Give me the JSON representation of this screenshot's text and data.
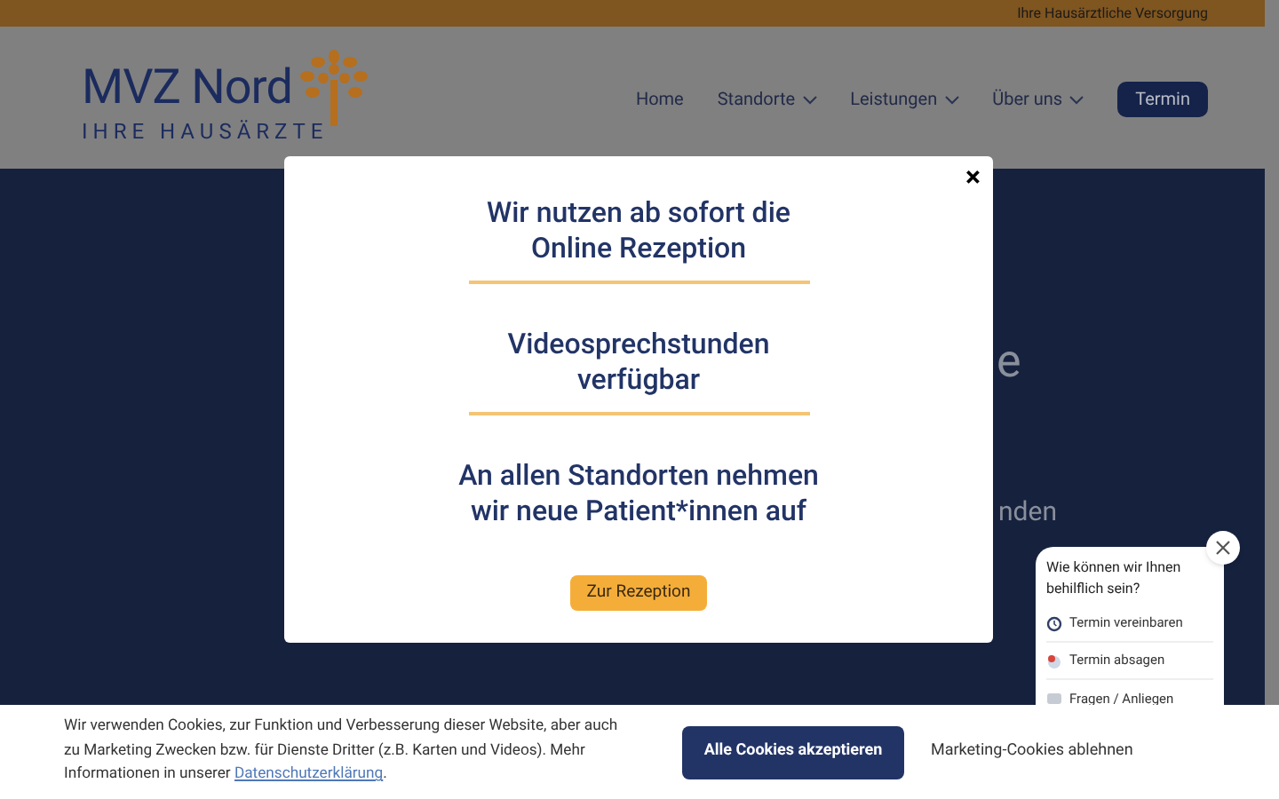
{
  "top_bar": {
    "text": "Ihre Hausärztliche Versorgung"
  },
  "logo": {
    "name": "MVZ Nord",
    "tagline": "IHRE HAUSÄRZTE"
  },
  "nav": [
    {
      "label": "Home",
      "dropdown": false
    },
    {
      "label": "Standorte",
      "dropdown": true
    },
    {
      "label": "Leistungen",
      "dropdown": true
    },
    {
      "label": "Über uns",
      "dropdown": true
    }
  ],
  "nav_button": "Termin",
  "hero_fragments": [
    "e",
    "nden"
  ],
  "modal": {
    "close": "×",
    "sections": [
      "Wir nutzen ab sofort die Online Rezeption",
      "Videosprechstunden verfügbar",
      "An allen Standorten nehmen wir neue Patient*innen auf"
    ],
    "button": "Zur Rezeption"
  },
  "chat": {
    "question": "Wie können wir Ihnen behilflich sein?",
    "options": [
      {
        "label": "Termin vereinbaren",
        "kind": "clock"
      },
      {
        "label": "Termin absagen",
        "kind": "cancel"
      },
      {
        "label": "Fragen / Anliegen",
        "kind": "chat"
      }
    ]
  },
  "cookie": {
    "text": "Wir verwenden Cookies, zur Funktion und Verbesserung dieser Website, aber auch zu Marketing Zwecken bzw. für Dienste Dritter (z.B. Karten und Videos). Mehr Informationen in unserer",
    "link": "Datenschutzerklärung",
    "after": ".",
    "accept": "Alle Cookies akzeptieren",
    "decline": "Marketing-Cookies ablehnen"
  }
}
